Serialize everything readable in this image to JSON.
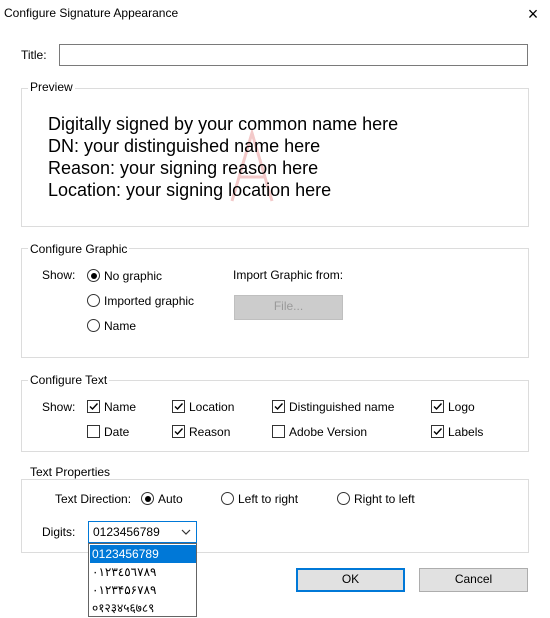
{
  "window": {
    "title": "Configure Signature Appearance",
    "close_icon": "×"
  },
  "title_field": {
    "label": "Title:",
    "value": ""
  },
  "preview": {
    "legend": "Preview",
    "lines": [
      "Digitally signed by your common name here",
      "DN: your distinguished name here",
      "Reason: your signing reason here",
      "Location: your signing location here"
    ]
  },
  "configure_graphic": {
    "legend": "Configure Graphic",
    "show_label": "Show:",
    "options": [
      "No graphic",
      "Imported graphic",
      "Name"
    ],
    "selected": "No graphic",
    "import_label": "Import Graphic from:",
    "file_button": "File..."
  },
  "configure_text": {
    "legend": "Configure Text",
    "show_label": "Show:",
    "items": [
      {
        "label": "Name",
        "checked": true
      },
      {
        "label": "Location",
        "checked": true
      },
      {
        "label": "Distinguished name",
        "checked": true
      },
      {
        "label": "Logo",
        "checked": true
      },
      {
        "label": "Date",
        "checked": false
      },
      {
        "label": "Reason",
        "checked": true
      },
      {
        "label": "Adobe Version",
        "checked": false
      },
      {
        "label": "Labels",
        "checked": true
      }
    ]
  },
  "text_properties": {
    "legend": "Text Properties",
    "direction_label": "Text Direction:",
    "directions": [
      "Auto",
      "Left to right",
      "Right to left"
    ],
    "selected_direction": "Auto",
    "digits_label": "Digits:",
    "digits_value": "0123456789",
    "digits_options": [
      "0123456789",
      "٠١٢٣٤٥٦٧٨٩",
      "۰۱۲۳۴۵۶۷۸۹",
      "०१२३४५६७८९"
    ]
  },
  "buttons": {
    "ok": "OK",
    "cancel": "Cancel"
  },
  "colors": {
    "accent": "#0078d7",
    "button_face": "#e1e1e1",
    "group_border": "#dcdcdc"
  }
}
